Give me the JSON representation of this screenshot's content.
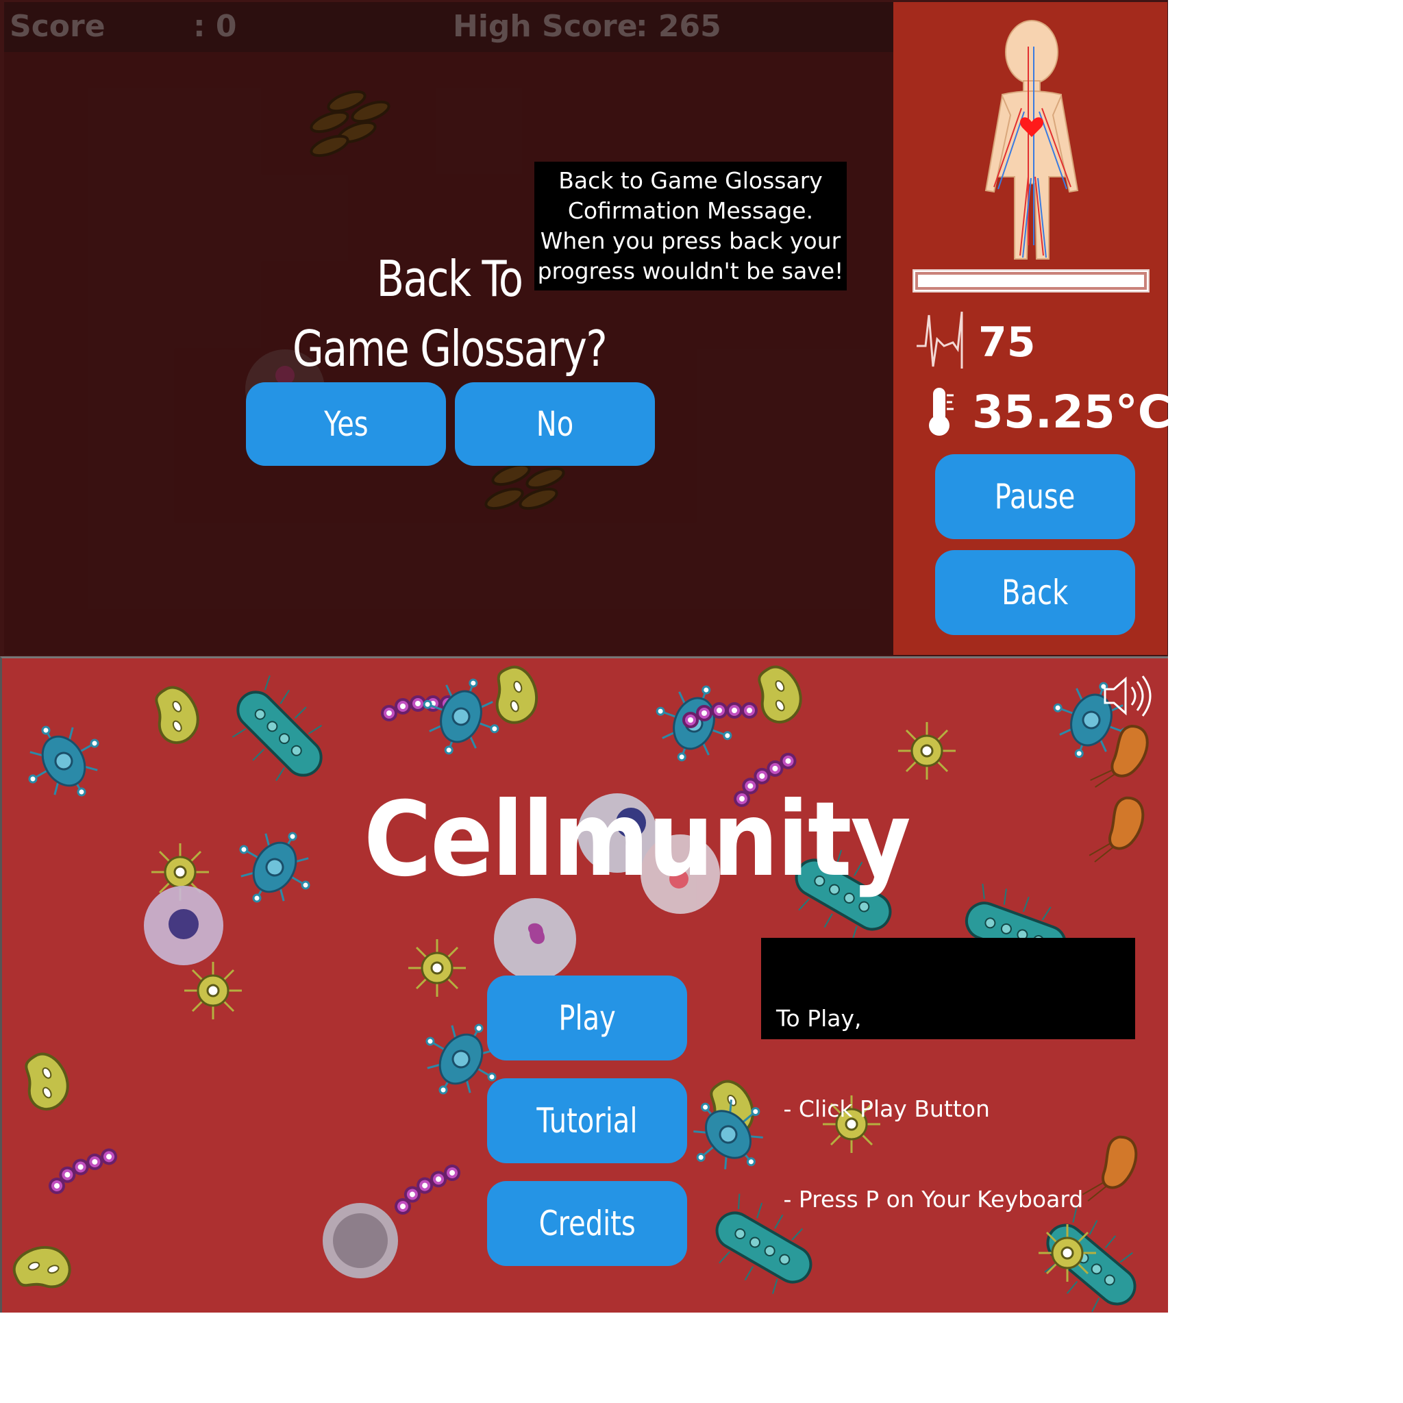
{
  "top": {
    "hud": {
      "score_label": "Score",
      "score_sep": ": 0",
      "highscore_label": "High Score",
      "highscore_sep": ": 265"
    },
    "dialog": {
      "title_line1": "Back To",
      "title_line2": "Game Glossary?",
      "yes_label": "Yes",
      "no_label": "No"
    },
    "annotation": {
      "line1": "Back to Game Glossary",
      "line2": "Cofirmation Message.",
      "line3": "When you press back your",
      "line4": "progress wouldn't be save!"
    },
    "side": {
      "health_fraction": 1.0,
      "heart_rate": "75",
      "temperature": "35.25°C",
      "pause_label": "Pause",
      "back_label": "Back"
    }
  },
  "bottom": {
    "title": "Cellmunity",
    "play_label": "Play",
    "tutorial_label": "Tutorial",
    "credits_label": "Credits",
    "annotation": {
      "line1": "To Play,",
      "line2": " - Click Play Button",
      "line3": " - Press P on Your Keyboard"
    }
  },
  "colors": {
    "button": "#2594e5",
    "top_bg": "#461515",
    "side_panel": "#a42a1c",
    "bottom_bg": "#ad3030"
  },
  "icons": [
    "human-body-icon",
    "heartbeat-icon",
    "thermometer-icon",
    "speaker-icon",
    "bacteria-icon",
    "virus-icon",
    "cell-icon"
  ]
}
